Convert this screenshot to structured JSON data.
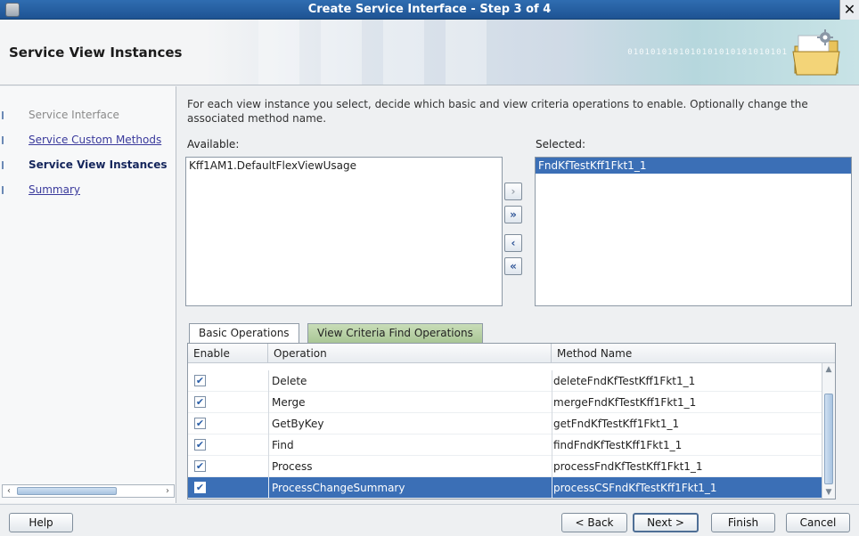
{
  "window": {
    "title": "Create Service Interface - Step 3 of 4",
    "close_glyph": "✕"
  },
  "header": {
    "page_heading": "Service View Instances",
    "binary_text": "0101010101010101010101010101",
    "graphic_icon": "folder-icon"
  },
  "nav": {
    "items": [
      {
        "label": "Service Interface",
        "state": "done"
      },
      {
        "label": "Service Custom Methods",
        "state": "link"
      },
      {
        "label": "Service View Instances",
        "state": "active"
      },
      {
        "label": "Summary",
        "state": "link"
      }
    ]
  },
  "content": {
    "intro": "For each view instance you select, decide which basic and view criteria operations to enable. Optionally change the associated method name.",
    "available_label": "Available:",
    "selected_label": "Selected:",
    "available_items": [
      "Kff1AM1.DefaultFlexViewUsage"
    ],
    "selected_items": [
      "FndKfTestKff1Fkt1_1"
    ],
    "shuttle": {
      "move": "›",
      "move_all": "»",
      "remove": "‹",
      "remove_all": "«"
    },
    "tabs": [
      {
        "label": "Basic Operations",
        "active": true
      },
      {
        "label": "View Criteria Find Operations",
        "active": false
      }
    ],
    "table": {
      "columns": [
        "Enable",
        "Operation",
        "Method Name"
      ],
      "rows": [
        {
          "enabled": true,
          "operation": "Delete",
          "method": "deleteFndKfTestKff1Fkt1_1",
          "selected": false
        },
        {
          "enabled": true,
          "operation": "Merge",
          "method": "mergeFndKfTestKff1Fkt1_1",
          "selected": false
        },
        {
          "enabled": true,
          "operation": "GetByKey",
          "method": "getFndKfTestKff1Fkt1_1",
          "selected": false
        },
        {
          "enabled": true,
          "operation": "Find",
          "method": "findFndKfTestKff1Fkt1_1",
          "selected": false
        },
        {
          "enabled": true,
          "operation": "Process",
          "method": "processFndKfTestKff1Fkt1_1",
          "selected": false
        },
        {
          "enabled": true,
          "operation": "ProcessChangeSummary",
          "method": "processCSFndKfTestKff1Fkt1_1",
          "selected": true
        }
      ]
    }
  },
  "footer": {
    "help": "Help",
    "back": "< Back",
    "next": "Next >",
    "finish": "Finish",
    "cancel": "Cancel"
  },
  "colors": {
    "title_bar": "#2f6db1",
    "selection": "#3b6fb6",
    "inactive_tab": "#b6d1a2"
  }
}
